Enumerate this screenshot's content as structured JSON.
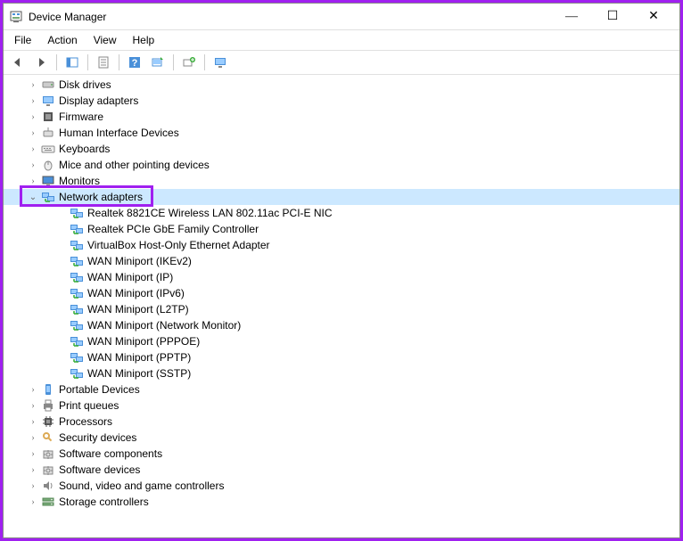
{
  "window": {
    "title": "Device Manager",
    "min_label": "—",
    "max_label": "☐",
    "close_label": "✕"
  },
  "menu": {
    "file": "File",
    "action": "Action",
    "view": "View",
    "help": "Help"
  },
  "tree": {
    "categories": [
      {
        "label": "Disk drives",
        "icon": "disk",
        "expanded": false
      },
      {
        "label": "Display adapters",
        "icon": "display",
        "expanded": false
      },
      {
        "label": "Firmware",
        "icon": "firmware",
        "expanded": false
      },
      {
        "label": "Human Interface Devices",
        "icon": "hid",
        "expanded": false
      },
      {
        "label": "Keyboards",
        "icon": "keyboard",
        "expanded": false
      },
      {
        "label": "Mice and other pointing devices",
        "icon": "mouse",
        "expanded": false
      },
      {
        "label": "Monitors",
        "icon": "monitor",
        "expanded": false
      },
      {
        "label": "Network adapters",
        "icon": "network",
        "expanded": true,
        "selected": true,
        "children": [
          {
            "label": "Realtek 8821CE Wireless LAN 802.11ac PCI-E NIC",
            "icon": "network"
          },
          {
            "label": "Realtek PCIe GbE Family Controller",
            "icon": "network"
          },
          {
            "label": "VirtualBox Host-Only Ethernet Adapter",
            "icon": "network"
          },
          {
            "label": "WAN Miniport (IKEv2)",
            "icon": "network"
          },
          {
            "label": "WAN Miniport (IP)",
            "icon": "network"
          },
          {
            "label": "WAN Miniport (IPv6)",
            "icon": "network"
          },
          {
            "label": "WAN Miniport (L2TP)",
            "icon": "network"
          },
          {
            "label": "WAN Miniport (Network Monitor)",
            "icon": "network"
          },
          {
            "label": "WAN Miniport (PPPOE)",
            "icon": "network"
          },
          {
            "label": "WAN Miniport (PPTP)",
            "icon": "network"
          },
          {
            "label": "WAN Miniport (SSTP)",
            "icon": "network"
          }
        ]
      },
      {
        "label": "Portable Devices",
        "icon": "portable",
        "expanded": false
      },
      {
        "label": "Print queues",
        "icon": "printer",
        "expanded": false
      },
      {
        "label": "Processors",
        "icon": "processor",
        "expanded": false
      },
      {
        "label": "Security devices",
        "icon": "security",
        "expanded": false
      },
      {
        "label": "Software components",
        "icon": "software",
        "expanded": false
      },
      {
        "label": "Software devices",
        "icon": "software",
        "expanded": false
      },
      {
        "label": "Sound, video and game controllers",
        "icon": "sound",
        "expanded": false
      },
      {
        "label": "Storage controllers",
        "icon": "storage",
        "expanded": false
      }
    ]
  }
}
